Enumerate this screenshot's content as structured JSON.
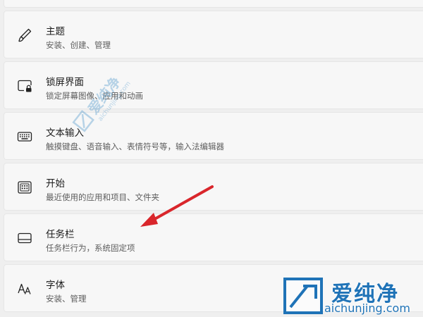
{
  "settings_list": {
    "items": [
      {
        "icon": "brush-icon",
        "title": "主题",
        "desc": "安装、创建、管理"
      },
      {
        "icon": "lock-screen-icon",
        "title": "锁屏界面",
        "desc": "锁定屏幕图像、应用和动画"
      },
      {
        "icon": "keyboard-icon",
        "title": "文本输入",
        "desc": "触摸键盘、语音输入、表情符号等，输入法编辑器"
      },
      {
        "icon": "start-menu-icon",
        "title": "开始",
        "desc": "最近使用的应用和项目、文件夹"
      },
      {
        "icon": "taskbar-icon",
        "title": "任务栏",
        "desc": "任务栏行为，系统固定项"
      },
      {
        "icon": "font-icon",
        "title": "字体",
        "desc": "安装、管理"
      }
    ]
  },
  "annotation": {
    "arrow_color": "#d9262b"
  },
  "watermark": {
    "brand_cn": "爱纯净",
    "brand_url": "aichunjing.com",
    "color": "#1f73b7"
  }
}
